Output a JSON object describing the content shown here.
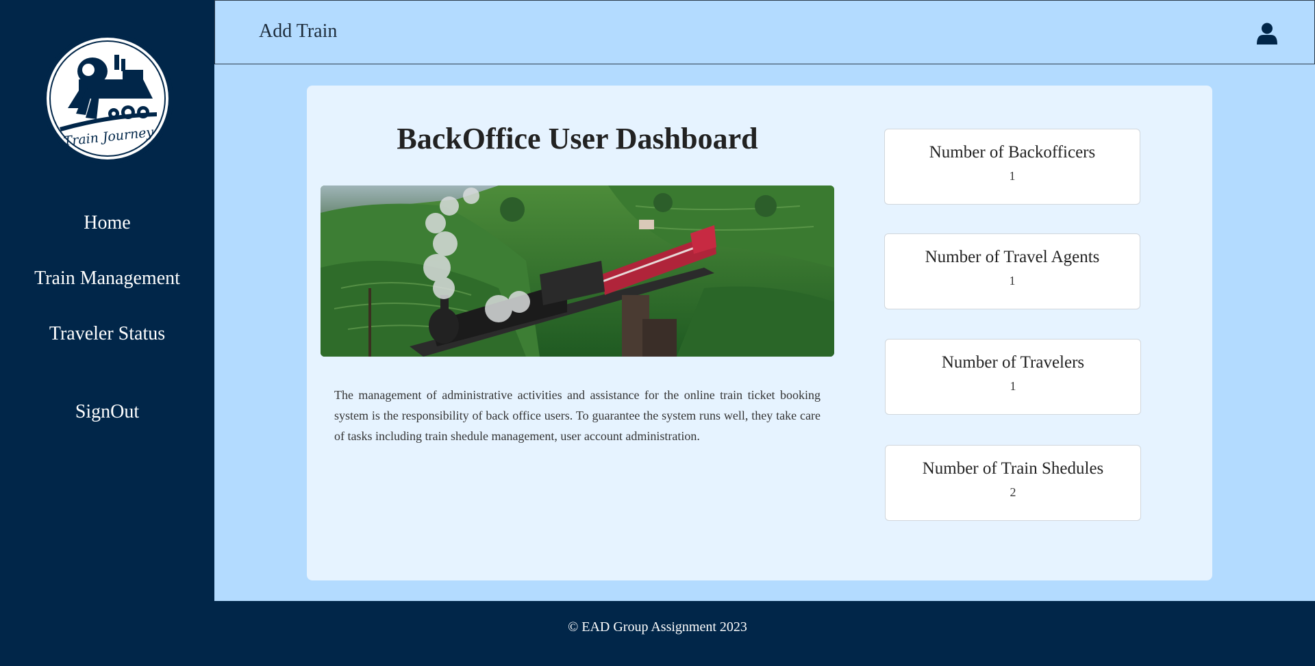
{
  "sidebar": {
    "logo_text": "Train Journey",
    "items": [
      {
        "label": "Home"
      },
      {
        "label": "Train Management"
      },
      {
        "label": "Traveler Status"
      },
      {
        "label": "SignOut"
      }
    ]
  },
  "header": {
    "title": "Add Train",
    "user_icon": "user-icon"
  },
  "main": {
    "title": "BackOffice User Dashboard",
    "hero_image": "steam-train-tea-plantation",
    "description": "The management of administrative activities and assistance for the online train ticket booking system is the responsibility of back office users. To guarantee the system runs well, they take care of tasks including train shedule management, user account administration.",
    "stats": [
      {
        "label": "Number of Backofficers",
        "value": "1"
      },
      {
        "label": "Number of Travel Agents",
        "value": "1"
      },
      {
        "label": "Number of Travelers",
        "value": "1"
      },
      {
        "label": "Number of Train Shedules",
        "value": "2"
      }
    ]
  },
  "footer": {
    "text": "© EAD Group Assignment 2023"
  },
  "colors": {
    "sidebar_bg": "#012649",
    "header_bg": "#b3dbff",
    "card_bg": "#e6f3ff"
  }
}
